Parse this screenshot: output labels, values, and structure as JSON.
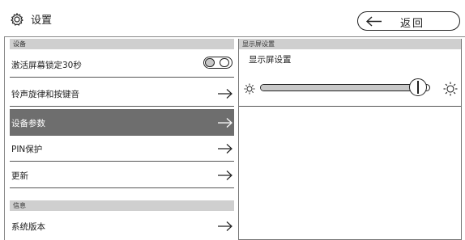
{
  "header": {
    "title": "设置",
    "gear_icon": "gear-icon",
    "back_label": "返回",
    "back_icon": "arrow-left-icon"
  },
  "left_panel": {
    "section_device": "设备",
    "rows": [
      {
        "label": "激活屏幕锁定30秒",
        "control": "toggle",
        "toggle_on": false
      },
      {
        "label": "铃声旋律和按键音",
        "control": "arrow"
      },
      {
        "label": "设备参数",
        "control": "arrow",
        "active": true
      },
      {
        "label": "PIN保护",
        "control": "arrow"
      },
      {
        "label": "更新",
        "control": "arrow"
      }
    ],
    "section_info": "信息",
    "info_rows": [
      {
        "label": "系统版本",
        "control": "arrow"
      }
    ]
  },
  "right_panel": {
    "section_header": "显示屏设置",
    "title": "显示屏设置",
    "brightness": 0.93,
    "min_icon": "brightness-low-icon",
    "max_icon": "brightness-high-icon"
  },
  "colors": {
    "active_row": "#6e6e6e",
    "section_bar": "#cfcfcf",
    "slider_fill": "#c8c8c8"
  }
}
